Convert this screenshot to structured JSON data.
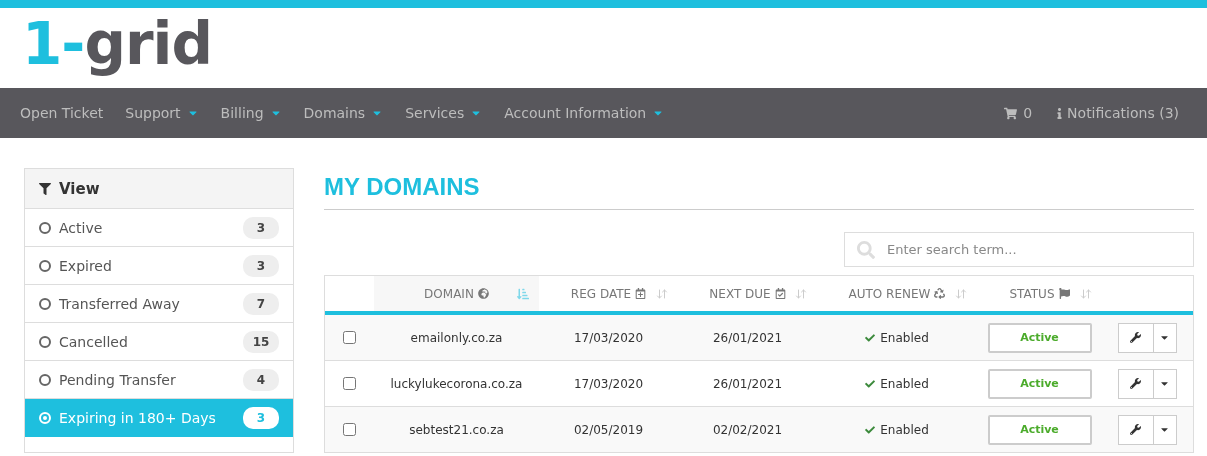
{
  "logo": {
    "prefix": "1-",
    "name": "grid"
  },
  "nav": {
    "items": [
      {
        "label": "Open Ticket",
        "dropdown": false
      },
      {
        "label": "Support",
        "dropdown": true
      },
      {
        "label": "Billing",
        "dropdown": true
      },
      {
        "label": "Domains",
        "dropdown": true
      },
      {
        "label": "Services",
        "dropdown": true
      },
      {
        "label": "Account Information",
        "dropdown": true
      }
    ],
    "cart": "0",
    "notifications": "Notifications (3)"
  },
  "sidebar": {
    "title": "View",
    "items": [
      {
        "label": "Active",
        "count": "3",
        "selected": false
      },
      {
        "label": "Expired",
        "count": "3",
        "selected": false
      },
      {
        "label": "Transferred Away",
        "count": "7",
        "selected": false
      },
      {
        "label": "Cancelled",
        "count": "15",
        "selected": false
      },
      {
        "label": "Pending Transfer",
        "count": "4",
        "selected": false
      },
      {
        "label": "Expiring in 180+ Days",
        "count": "3",
        "selected": true
      }
    ]
  },
  "page_title": "MY DOMAINS",
  "search": {
    "placeholder": "Enter search term..."
  },
  "table": {
    "columns": [
      {
        "label": "DOMAIN",
        "sorted": true
      },
      {
        "label": "REG DATE",
        "sorted": false
      },
      {
        "label": "NEXT DUE",
        "sorted": false
      },
      {
        "label": "AUTO RENEW",
        "sorted": false
      },
      {
        "label": "STATUS",
        "sorted": false
      }
    ],
    "rows": [
      {
        "checked": false,
        "domain": "emailonly.co.za",
        "reg_date": "17/03/2020",
        "next_due": "26/01/2021",
        "auto_renew": "Enabled",
        "status": "Active"
      },
      {
        "checked": false,
        "domain": "luckylukecorona.co.za",
        "reg_date": "17/03/2020",
        "next_due": "26/01/2021",
        "auto_renew": "Enabled",
        "status": "Active"
      },
      {
        "checked": false,
        "domain": "sebtest21.co.za",
        "reg_date": "02/05/2019",
        "next_due": "02/02/2021",
        "auto_renew": "Enabled",
        "status": "Active"
      }
    ]
  }
}
